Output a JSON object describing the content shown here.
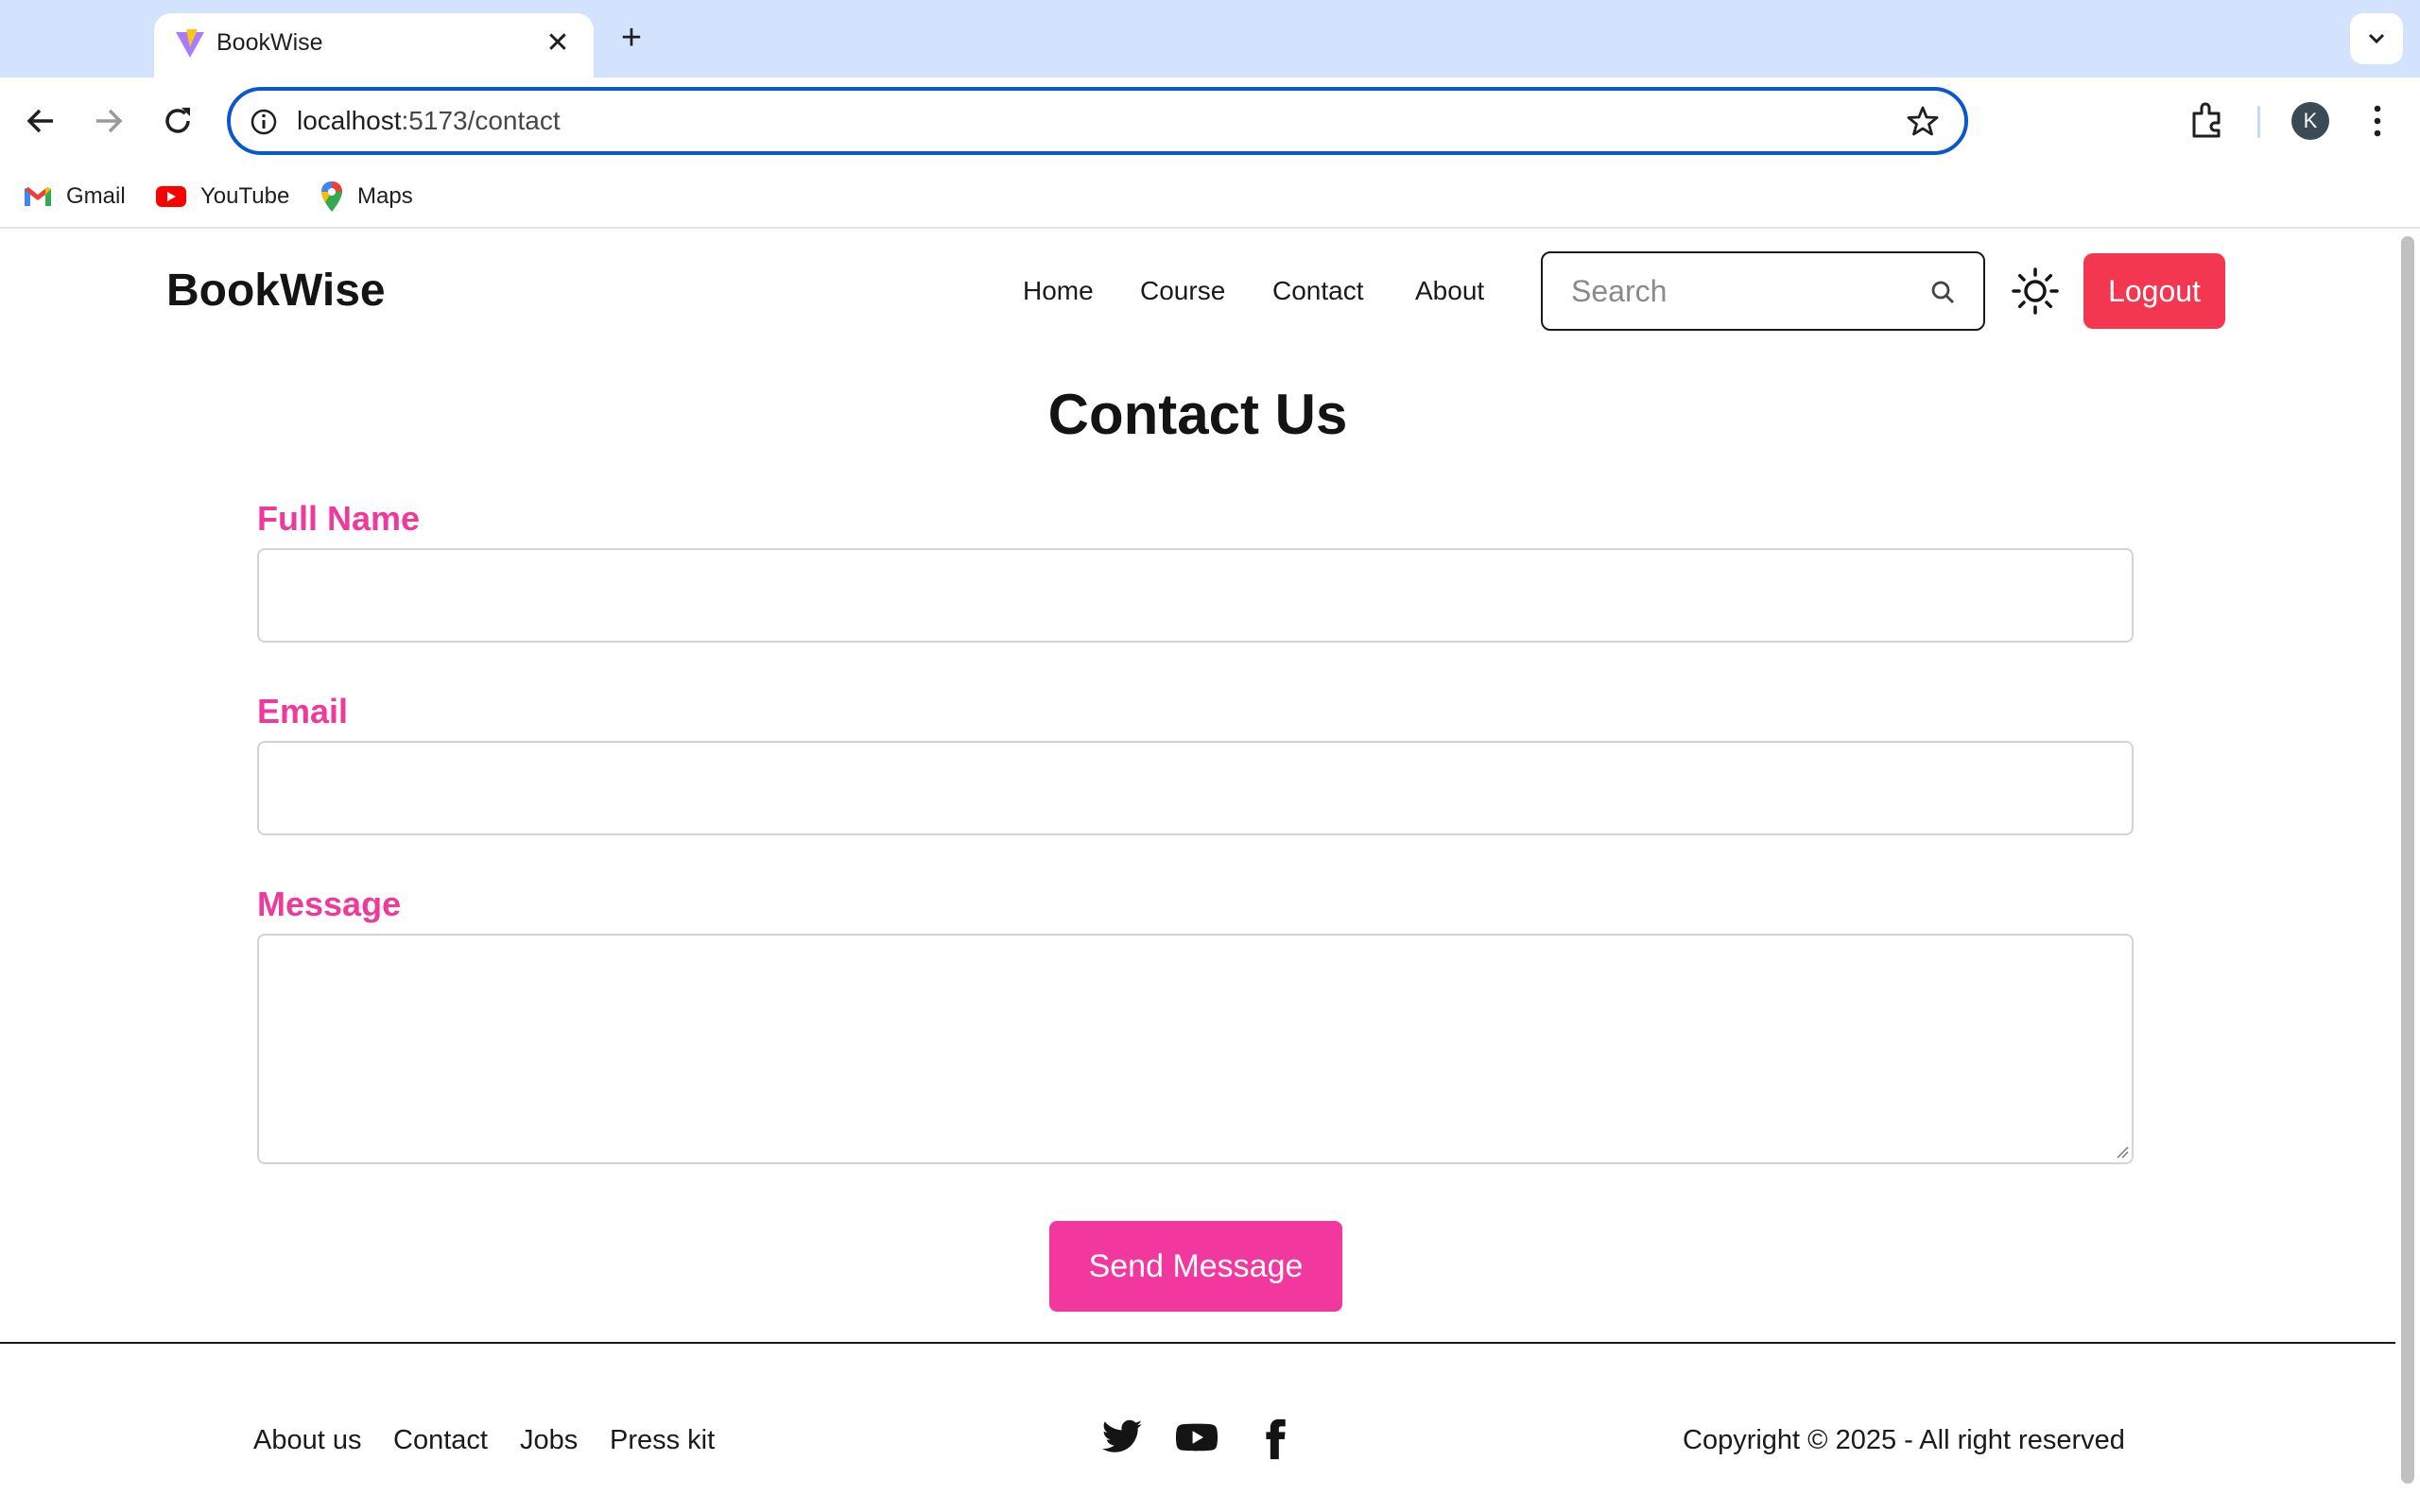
{
  "browser": {
    "tab_title": "BookWise",
    "url_host": "localhost",
    "url_path": ":5173/contact",
    "profile_initial": "K",
    "bookmarks": [
      {
        "label": "Gmail",
        "icon": "gmail-icon"
      },
      {
        "label": "YouTube",
        "icon": "youtube-icon"
      },
      {
        "label": "Maps",
        "icon": "maps-icon"
      }
    ],
    "accent_color": "#0b57d0"
  },
  "site": {
    "brand": "BookWise",
    "nav": [
      "Home",
      "Course",
      "Contact",
      "About"
    ],
    "search_placeholder": "Search",
    "logout_label": "Logout",
    "logout_color": "#f43751"
  },
  "contact": {
    "title": "Contact Us",
    "fields": {
      "full_name": {
        "label": "Full Name",
        "value": ""
      },
      "email": {
        "label": "Email",
        "value": ""
      },
      "message": {
        "label": "Message",
        "value": ""
      }
    },
    "label_color": "#ee3a9b",
    "submit_label": "Send Message",
    "submit_color": "#f2389e"
  },
  "footer": {
    "links": [
      "About us",
      "Contact",
      "Jobs",
      "Press kit"
    ],
    "social": [
      "twitter-icon",
      "youtube-icon",
      "facebook-icon"
    ],
    "copyright": "Copyright © 2025 - All right reserved"
  }
}
